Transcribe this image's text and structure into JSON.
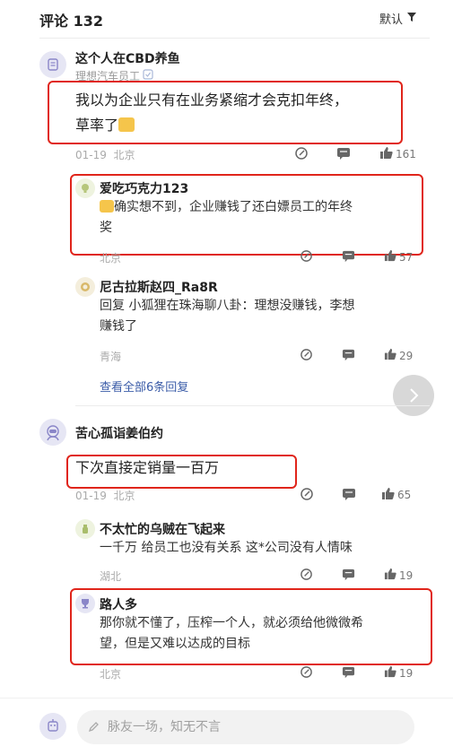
{
  "header": {
    "title": "评论 132",
    "sort_label": "默认"
  },
  "comments": [
    {
      "author": "这个人在CBD养鱼",
      "tag": "理想汽车员工",
      "text_line1": "我以为企业只有在业务紧缩才会克扣年终，",
      "text_line2": "草率了",
      "date": "01-19",
      "location": "北京",
      "likes": "161",
      "replies": [
        {
          "author": "爱吃巧克力123",
          "text_line1": "确实想不到，企业赚钱了还白嫖员工的年终",
          "text_line2": "奖",
          "location": "北京",
          "likes": "57"
        },
        {
          "author": "尼古拉斯赵四_Ra8R",
          "text_line1": "回复 小狐狸在珠海聊八卦：理想没赚钱，李想",
          "text_line2": "赚钱了",
          "location": "青海",
          "likes": "29"
        }
      ],
      "view_all": "查看全部6条回复"
    },
    {
      "author": "苦心孤诣姜伯约",
      "text": "下次直接定销量一百万",
      "date": "01-19",
      "location": "北京",
      "likes": "65",
      "replies": [
        {
          "author": "不太忙的乌贼在飞起来",
          "text_line1": "一千万 给员工也没有关系 这*公司没有人情味",
          "location": "湖北",
          "likes": "19"
        },
        {
          "author": "路人多",
          "text_line1": "那你就不懂了，压榨一个人，就必须给他微微希",
          "text_line2": "望，但是又难以达成的目标",
          "location": "北京",
          "likes": "19"
        }
      ]
    }
  ],
  "input": {
    "placeholder": "脉友一场，知无不言"
  },
  "colors": {
    "highlight": "#e0251b",
    "link": "#3b5ca8"
  }
}
